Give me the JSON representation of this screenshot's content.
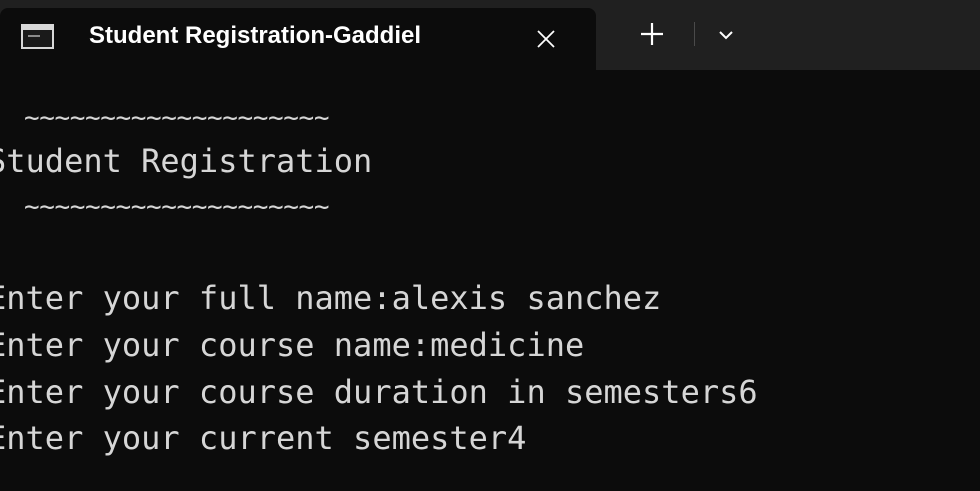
{
  "tab": {
    "title": "Student Registration-Gaddiel",
    "icon": "terminal-icon"
  },
  "tabbar": {
    "close_icon": "close-icon",
    "new_tab_icon": "plus-icon",
    "dropdown_icon": "chevron-down-icon"
  },
  "terminal": {
    "lines": [
      "~~~~~~~~~~~~~~~~~~~~",
      "Student Registration",
      "~~~~~~~~~~~~~~~~~~~~",
      "",
      "Enter your full name:alexis sanchez",
      "Enter your course name:medicine",
      "Enter your course duration in semesters6",
      "Enter your current semester4"
    ]
  },
  "colors": {
    "background": "#0c0c0c",
    "titlebar": "#202020",
    "text": "#d6d6d6"
  }
}
